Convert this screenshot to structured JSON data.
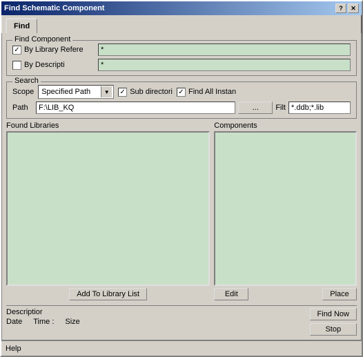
{
  "window": {
    "title": "Find Schematic Component",
    "help_button": "?",
    "close_button": "✕"
  },
  "tabs": [
    {
      "label": "Find",
      "active": true
    }
  ],
  "find_component": {
    "legend": "Find Component",
    "by_library_ref": {
      "label": "By Library Refere",
      "checked": true,
      "value": "*"
    },
    "by_description": {
      "label": "By Descripti",
      "checked": false,
      "value": "*"
    }
  },
  "search": {
    "legend": "Search",
    "scope_label": "Scope",
    "scope_value": "Specified Path",
    "sub_directories_label": "Sub directori",
    "sub_directories_checked": true,
    "find_all_instances_label": "Find All Instan",
    "find_all_instances_checked": true,
    "path_label": "Path",
    "path_value": "F:\\LIB_KQ",
    "browse_label": "...",
    "filter_label": "Filt",
    "filter_value": "*.ddb;*.lib"
  },
  "found_libraries": {
    "label": "Found Libraries"
  },
  "components": {
    "label": "Components"
  },
  "buttons": {
    "add_to_library_list": "Add To Library List",
    "edit": "Edit",
    "place": "Place",
    "find_now": "Find Now",
    "stop": "Stop"
  },
  "description": {
    "label": "Descriptior",
    "value": ""
  },
  "date_row": {
    "date_label": "Date",
    "date_value": "",
    "time_label": "Time :",
    "time_value": "",
    "size_label": "Size",
    "size_value": ""
  },
  "status_bar": {
    "text": ""
  },
  "help_bar": {
    "help_label": "Help"
  }
}
